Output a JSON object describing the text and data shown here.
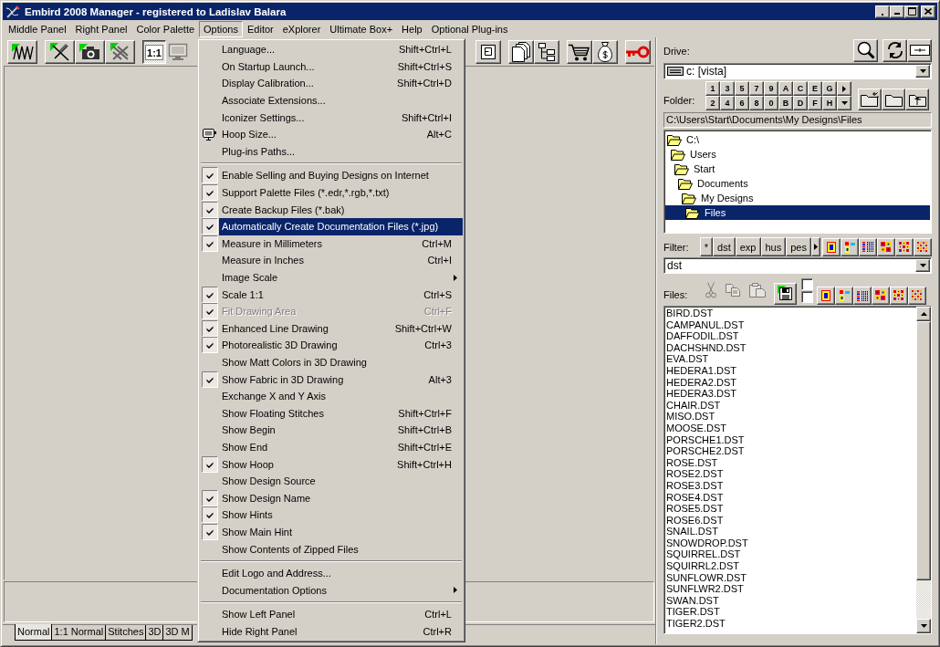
{
  "window": {
    "title": "Embird 2008 Manager - registered to Ladislav Balara"
  },
  "menu_bar": [
    {
      "label": "Middle Panel",
      "selected": false
    },
    {
      "label": "Right Panel",
      "selected": false
    },
    {
      "label": "Color Palette",
      "selected": false
    },
    {
      "label": "Options",
      "selected": true
    },
    {
      "label": "Editor",
      "selected": false
    },
    {
      "label": "eXplorer",
      "selected": false
    },
    {
      "label": "Ultimate Box+",
      "selected": false
    },
    {
      "label": "Help",
      "selected": false
    },
    {
      "label": "Optional Plug-ins",
      "selected": false
    }
  ],
  "toolbar": {
    "left_groups": [
      [
        {
          "pressed": false,
          "disabled": false
        }
      ],
      [
        {
          "pressed": false,
          "disabled": false
        },
        {
          "pressed": false,
          "disabled": false
        },
        {
          "pressed": false,
          "disabled": false
        }
      ],
      [
        {
          "label": "1:1",
          "pressed": true,
          "disabled": false
        },
        {
          "pressed": false,
          "disabled": true
        }
      ]
    ],
    "right_groups": [
      [
        {
          "pressed": false,
          "disabled": false
        }
      ],
      [
        {
          "pressed": false,
          "disabled": false
        },
        {
          "pressed": false,
          "disabled": false
        }
      ],
      [
        {
          "pressed": false,
          "disabled": false
        },
        {
          "pressed": false,
          "disabled": false
        }
      ],
      [
        {
          "pressed": false,
          "disabled": false
        }
      ]
    ]
  },
  "options_menu": {
    "sections": [
      {
        "items": [
          {
            "label": "Language...",
            "shortcut": "Shift+Ctrl+L",
            "kind": "command",
            "checked": false,
            "disabled": false,
            "selected": false
          },
          {
            "label": "On Startup Launch...",
            "shortcut": "Shift+Ctrl+S",
            "kind": "command",
            "checked": false,
            "disabled": false,
            "selected": false
          },
          {
            "label": "Display Calibration...",
            "shortcut": "Shift+Ctrl+D",
            "kind": "command",
            "checked": false,
            "disabled": false,
            "selected": false
          },
          {
            "label": "Associate Extensions...",
            "kind": "command",
            "checked": false,
            "disabled": false,
            "selected": false
          },
          {
            "label": "Iconizer Settings...",
            "shortcut": "Shift+Ctrl+I",
            "kind": "command",
            "checked": false,
            "disabled": false,
            "selected": false
          },
          {
            "label": "Hoop Size...",
            "shortcut": "Alt+C",
            "kind": "icon",
            "checked": false,
            "disabled": false,
            "selected": false
          },
          {
            "label": "Plug-ins Paths...",
            "kind": "command",
            "checked": false,
            "disabled": false,
            "selected": false
          }
        ]
      },
      {
        "items": [
          {
            "label": "Enable Selling and Buying Designs on Internet",
            "kind": "command",
            "checked": true,
            "disabled": false,
            "selected": false
          },
          {
            "label": "Support Palette Files (*.edr,*.rgb,*.txt)",
            "kind": "command",
            "checked": true,
            "disabled": false,
            "selected": false
          },
          {
            "label": "Create Backup Files (*.bak)",
            "kind": "command",
            "checked": true,
            "disabled": false,
            "selected": false
          },
          {
            "label": "Automatically Create Documentation Files (*.jpg)",
            "kind": "command",
            "checked": true,
            "disabled": false,
            "selected": true
          },
          {
            "label": "Measure in Millimeters",
            "shortcut": "Ctrl+M",
            "kind": "command",
            "checked": true,
            "disabled": false,
            "selected": false
          },
          {
            "label": "Measure in Inches",
            "shortcut": "Ctrl+I",
            "kind": "command",
            "checked": false,
            "disabled": false,
            "selected": false
          },
          {
            "label": "Image Scale",
            "kind": "submenu",
            "checked": false,
            "disabled": false,
            "selected": false
          },
          {
            "label": "Scale 1:1",
            "shortcut": "Ctrl+S",
            "kind": "command",
            "checked": true,
            "disabled": false,
            "selected": false
          },
          {
            "label": "Fit Drawing Area",
            "shortcut": "Ctrl+F",
            "kind": "command",
            "checked": true,
            "disabled": true,
            "selected": false
          },
          {
            "label": "Enhanced Line Drawing",
            "shortcut": "Shift+Ctrl+W",
            "kind": "command",
            "checked": true,
            "disabled": false,
            "selected": false
          },
          {
            "label": "Photorealistic 3D Drawing",
            "shortcut": "Ctrl+3",
            "kind": "command",
            "checked": true,
            "disabled": false,
            "selected": false
          },
          {
            "label": "Show Matt Colors in 3D Drawing",
            "kind": "command",
            "checked": false,
            "disabled": false,
            "selected": false
          },
          {
            "label": "Show Fabric in 3D Drawing",
            "shortcut": "Alt+3",
            "kind": "command",
            "checked": true,
            "disabled": false,
            "selected": false
          },
          {
            "label": "Exchange X and Y Axis",
            "kind": "command",
            "checked": false,
            "disabled": false,
            "selected": false
          },
          {
            "label": "Show Floating Stitches",
            "shortcut": "Shift+Ctrl+F",
            "kind": "command",
            "checked": false,
            "disabled": false,
            "selected": false
          },
          {
            "label": "Show Begin",
            "shortcut": "Shift+Ctrl+B",
            "kind": "command",
            "checked": false,
            "disabled": false,
            "selected": false
          },
          {
            "label": "Show End",
            "shortcut": "Shift+Ctrl+E",
            "kind": "command",
            "checked": false,
            "disabled": false,
            "selected": false
          },
          {
            "label": "Show Hoop",
            "shortcut": "Shift+Ctrl+H",
            "kind": "command",
            "checked": true,
            "disabled": false,
            "selected": false
          },
          {
            "label": "Show Design Source",
            "kind": "command",
            "checked": false,
            "disabled": false,
            "selected": false
          },
          {
            "label": "Show Design Name",
            "kind": "command",
            "checked": true,
            "disabled": false,
            "selected": false
          },
          {
            "label": "Show Hints",
            "kind": "command",
            "checked": true,
            "disabled": false,
            "selected": false
          },
          {
            "label": "Show Main Hint",
            "kind": "command",
            "checked": true,
            "disabled": false,
            "selected": false
          },
          {
            "label": "Show Contents of Zipped Files",
            "kind": "command",
            "checked": false,
            "disabled": false,
            "selected": false
          }
        ]
      },
      {
        "items": [
          {
            "label": "Edit Logo and Address...",
            "kind": "command",
            "checked": false,
            "disabled": false,
            "selected": false
          },
          {
            "label": "Documentation Options",
            "kind": "submenu",
            "checked": false,
            "disabled": false,
            "selected": false
          }
        ]
      },
      {
        "items": [
          {
            "label": "Show Left Panel",
            "shortcut": "Ctrl+L",
            "kind": "command",
            "checked": false,
            "disabled": false,
            "selected": false
          },
          {
            "label": "Hide Right Panel",
            "shortcut": "Ctrl+R",
            "kind": "command",
            "checked": false,
            "disabled": false,
            "selected": false
          }
        ]
      }
    ]
  },
  "view_tabs": [
    {
      "label": "Normal",
      "selected": true
    },
    {
      "label": "1:1 Normal",
      "selected": false
    },
    {
      "label": "Stitches",
      "selected": false
    },
    {
      "label": "3D",
      "selected": false
    },
    {
      "label": "3D M",
      "selected": false
    }
  ],
  "right_panel": {
    "drive_label": "Drive:",
    "drive": "c: [vista]",
    "folder_label": "Folder:",
    "folder_shortcuts": [
      [
        "1",
        "3",
        "5",
        "7",
        "9",
        "A",
        "C",
        "E",
        "G"
      ],
      [
        "2",
        "4",
        "6",
        "8",
        "0",
        "B",
        "D",
        "F",
        "H"
      ]
    ],
    "path": "C:\\Users\\Start\\Documents\\My Designs\\Files",
    "folder_tree": [
      {
        "label": "C:\\",
        "selected": false,
        "children": [
          {
            "label": "Users",
            "selected": false,
            "children": [
              {
                "label": "Start",
                "selected": false,
                "children": [
                  {
                    "label": "Documents",
                    "selected": false,
                    "children": [
                      {
                        "label": "My Designs",
                        "selected": false,
                        "children": [
                          {
                            "label": "Files",
                            "selected": true
                          }
                        ]
                      }
                    ]
                  }
                ]
              }
            ]
          }
        ]
      }
    ],
    "filter_label": "Filter:",
    "filter_buttons": [
      "*",
      "dst",
      "exp",
      "hus",
      "pes"
    ],
    "filter": "dst",
    "files_label": "Files:",
    "edit_tools": [
      {
        "disabled": true
      },
      {
        "disabled": true
      },
      {
        "disabled": true
      }
    ],
    "checkboxes": [
      {
        "checked": false
      },
      {
        "checked": false
      }
    ],
    "files": [
      {
        "name": "BIRD.DST",
        "selected": false
      },
      {
        "name": "CAMPANUL.DST",
        "selected": false
      },
      {
        "name": "DAFFODIL.DST",
        "selected": false
      },
      {
        "name": "DACHSHND.DST",
        "selected": false
      },
      {
        "name": "EVA.DST",
        "selected": false
      },
      {
        "name": "HEDERA1.DST",
        "selected": false
      },
      {
        "name": "HEDERA2.DST",
        "selected": false
      },
      {
        "name": "HEDERA3.DST",
        "selected": false
      },
      {
        "name": "CHAIR.DST",
        "selected": false
      },
      {
        "name": "MISO.DST",
        "selected": false
      },
      {
        "name": "MOOSE.DST",
        "selected": false
      },
      {
        "name": "PORSCHE1.DST",
        "selected": false
      },
      {
        "name": "PORSCHE2.DST",
        "selected": false
      },
      {
        "name": "ROSE.DST",
        "selected": false
      },
      {
        "name": "ROSE2.DST",
        "selected": false
      },
      {
        "name": "ROSE3.DST",
        "selected": false
      },
      {
        "name": "ROSE4.DST",
        "selected": false
      },
      {
        "name": "ROSE5.DST",
        "selected": false
      },
      {
        "name": "ROSE6.DST",
        "selected": false
      },
      {
        "name": "SNAIL.DST",
        "selected": false
      },
      {
        "name": "SNOWDROP.DST",
        "selected": false
      },
      {
        "name": "SQUIRREL.DST",
        "selected": false
      },
      {
        "name": "SQUIRRL2.DST",
        "selected": false
      },
      {
        "name": "SUNFLOWR.DST",
        "selected": false
      },
      {
        "name": "SUNFLWR2.DST",
        "selected": false
      },
      {
        "name": "SWAN.DST",
        "selected": false
      },
      {
        "name": "TIGER.DST",
        "selected": false
      },
      {
        "name": "TIGER2.DST",
        "selected": false
      }
    ]
  }
}
